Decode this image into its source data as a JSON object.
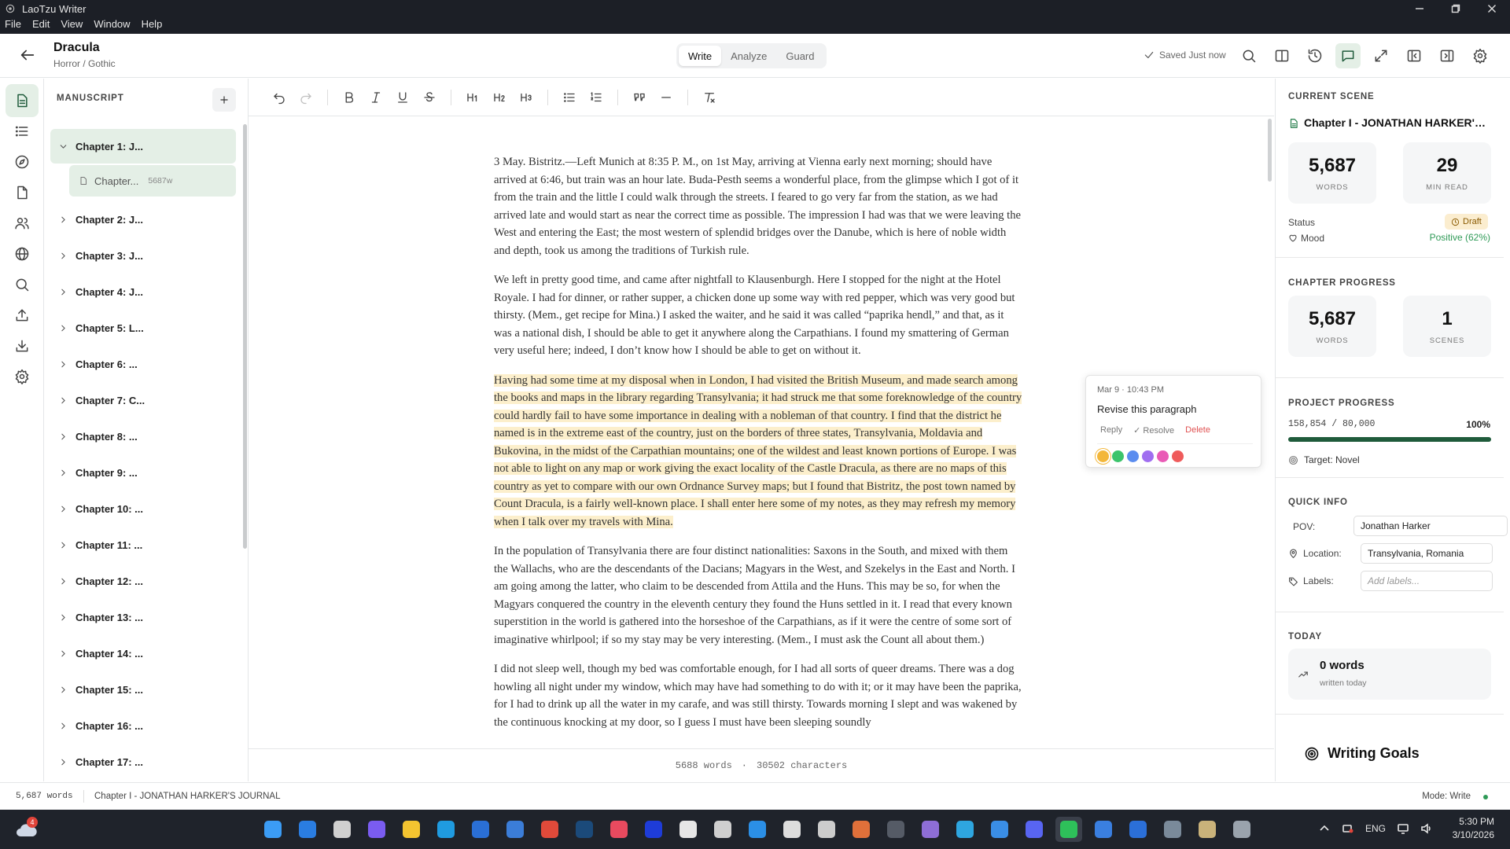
{
  "os": {
    "window_title": "LaoTzu Writer",
    "menu": [
      "File",
      "Edit",
      "View",
      "Window",
      "Help"
    ]
  },
  "header": {
    "title": "Dracula",
    "genre": "Horror / Gothic",
    "tabs": [
      "Write",
      "Analyze",
      "Guard"
    ],
    "active_tab": "Write",
    "saved_status": "Saved Just now",
    "tools": [
      "search-icon",
      "split-view-icon",
      "history-icon",
      "comments-icon",
      "expand-icon",
      "left-panel-icon",
      "right-panel-icon",
      "settings-icon"
    ]
  },
  "rail": [
    "manuscript-icon",
    "outline-icon",
    "compass-icon",
    "notes-icon",
    "characters-icon",
    "world-icon",
    "search-icon",
    "export-icon",
    "import-icon",
    "settings-icon"
  ],
  "manuscript": {
    "title": "MANUSCRIPT",
    "open_chapter": "Chapter 1: J...",
    "scene": {
      "label": "Chapter...",
      "words": "5687w"
    },
    "chapters": [
      "Chapter 2: J...",
      "Chapter 3: J...",
      "Chapter 4: J...",
      "Chapter 5: L...",
      "Chapter 6: ...",
      "Chapter 7: C...",
      "Chapter 8: ...",
      "Chapter 9: ...",
      "Chapter 10: ...",
      "Chapter 11: ...",
      "Chapter 12: ...",
      "Chapter 13: ...",
      "Chapter 14: ...",
      "Chapter 15: ...",
      "Chapter 16: ...",
      "Chapter 17: ..."
    ]
  },
  "editor": {
    "paragraphs": [
      "3 May. Bistritz.—Left Munich at 8:35 P. M., on 1st May, arriving at Vienna early next morning; should have arrived at 6:46, but train was an hour late. Buda-Pesth seems a wonderful place, from the glimpse which I got of it from the train and the little I could walk through the streets. I feared to go very far from the station, as we had arrived late and would start as near the correct time as possible. The impression I had was that we were leaving the West and entering the East; the most western of splendid bridges over the Danube, which is here of noble width and depth, took us among the traditions of Turkish rule.",
      "We left in pretty good time, and came after nightfall to Klausenburgh. Here I stopped for the night at the Hotel Royale. I had for dinner, or rather supper, a chicken done up some way with red pepper, which was very good but thirsty. (Mem., get recipe for Mina.) I asked the waiter, and he said it was called “paprika hendl,” and that, as it was a national dish, I should be able to get it anywhere along the Carpathians. I found my smattering of German very useful here; indeed, I don’t know how I should be able to get on without it.",
      "Having had some time at my disposal when in London, I had visited the British Museum, and made search among the books and maps in the library regarding Transylvania; it had struck me that some foreknowledge of the country could hardly fail to have some importance in dealing with a nobleman of that country. I find that the district he named is in the extreme east of the country, just on the borders of three states, Transylvania, Moldavia and Bukovina, in the midst of the Carpathian mountains; one of the wildest and least known portions of Europe. I was not able to light on any map or work giving the exact locality of the Castle Dracula, as there are no maps of this country as yet to compare with our own Ordnance Survey maps; but I found that Bistritz, the post town named by Count Dracula, is a fairly well-known place. I shall enter here some of my notes, as they may refresh my memory when I talk over my travels with Mina.",
      "In the population of Transylvania there are four distinct nationalities: Saxons in the South, and mixed with them the Wallachs, who are the descendants of the Dacians; Magyars in the West, and Szekelys in the East and North. I am going among the latter, who claim to be descended from Attila and the Huns. This may be so, for when the Magyars conquered the country in the eleventh century they found the Huns settled in it. I read that every known superstition in the world is gathered into the horseshoe of the Carpathians, as if it were the centre of some sort of imaginative whirlpool; if so my stay may be very interesting. (Mem., I must ask the Count all about them.)",
      "I did not sleep well, though my bed was comfortable enough, for I had all sorts of queer dreams. There was a dog howling all night under my window, which may have had something to do with it; or it may have been the paprika, for I had to drink up all the water in my carafe, and was still thirsty. Towards morning I slept and was wakened by the continuous knocking at my door, so I guess I must have been sleeping soundly"
    ],
    "footer_words": "5688 words",
    "footer_sep": "·",
    "footer_chars": "30502 characters"
  },
  "comment": {
    "date": "Mar 9 · 10:43 PM",
    "text": "Revise this paragraph",
    "reply": "Reply",
    "resolve": "✓ Resolve",
    "delete": "Delete",
    "colors": [
      "#f3b73a",
      "#3cc46b",
      "#5b8def",
      "#a06ef0",
      "#e95bb6",
      "#ef5b5b"
    ]
  },
  "right": {
    "current_scene_title": "CURRENT SCENE",
    "scene_name": "Chapter I - JONATHAN HARKER'S JOURNAL",
    "words": "5,687",
    "words_label": "WORDS",
    "min_read": "29",
    "min_read_label": "MIN READ",
    "status_label": "Status",
    "status_value": "Draft",
    "mood_label": "Mood",
    "mood_value": "Positive (62%)",
    "chapter_progress_title": "CHAPTER PROGRESS",
    "ch_words": "5,687",
    "ch_words_label": "WORDS",
    "ch_scenes": "1",
    "ch_scenes_label": "SCENES",
    "project_progress_title": "PROJECT PROGRESS",
    "project_count": "158,854 / 80,000",
    "project_pct": "100%",
    "project_fill": 1.0,
    "target": "Target: Novel",
    "quick_info_title": "QUICK INFO",
    "pov_label": "POV:",
    "pov_value": "Jonathan Harker",
    "location_label": "Location:",
    "location_value": "Transylvania, Romania",
    "labels_label": "Labels:",
    "labels_placeholder": "Add labels...",
    "today_title": "TODAY",
    "today_words": "0 words",
    "today_sub": "written today",
    "writing_goals": "Writing Goals"
  },
  "statusbar": {
    "words": "5,687 words",
    "chapter": "Chapter I - JONATHAN HARKER'S JOURNAL",
    "mode": "Mode: Write"
  },
  "taskbar": {
    "weather_badge": "4",
    "lang": "ENG",
    "time": "5:30 PM",
    "date": "3/10/2026",
    "apps": [
      {
        "name": "start-icon",
        "color": "#3b9cf5"
      },
      {
        "name": "search-icon",
        "color": "#2a7de1"
      },
      {
        "name": "task-view-icon",
        "color": "#d0d0d0"
      },
      {
        "name": "copilot-icon",
        "color": "#7a5cf0"
      },
      {
        "name": "file-explorer-icon",
        "color": "#f4c430"
      },
      {
        "name": "edge-icon",
        "color": "#1f9be0"
      },
      {
        "name": "mail-icon",
        "color": "#2a6fd6"
      },
      {
        "name": "app-icon",
        "color": "#3b7dd8"
      },
      {
        "name": "chrome-icon",
        "color": "#e04a3a"
      },
      {
        "name": "steam-icon",
        "color": "#1b4a7a"
      },
      {
        "name": "app-icon",
        "color": "#e84a5f"
      },
      {
        "name": "app-icon",
        "color": "#1e3cd8"
      },
      {
        "name": "app-icon",
        "color": "#e6e6e6"
      },
      {
        "name": "chatgpt-icon",
        "color": "#cfcfcf"
      },
      {
        "name": "vscode-icon",
        "color": "#2b8fe6"
      },
      {
        "name": "app-icon",
        "color": "#dddddd"
      },
      {
        "name": "app-icon",
        "color": "#cccccc"
      },
      {
        "name": "claude-icon",
        "color": "#e0703a"
      },
      {
        "name": "terminal-icon",
        "color": "#555b66"
      },
      {
        "name": "github-icon",
        "color": "#8e6ed6"
      },
      {
        "name": "telegram-icon",
        "color": "#2ea6e0"
      },
      {
        "name": "photos-icon",
        "color": "#3a8ee6"
      },
      {
        "name": "discord-icon",
        "color": "#5865f2"
      },
      {
        "name": "wechat-icon",
        "color": "#2ec05a"
      },
      {
        "name": "notes-icon",
        "color": "#3a7fe0"
      },
      {
        "name": "shield-icon",
        "color": "#2b6fd8"
      },
      {
        "name": "settings-icon",
        "color": "#7a8a9a"
      },
      {
        "name": "app-icon",
        "color": "#c9b27a"
      },
      {
        "name": "laotzu-icon",
        "color": "#9aa3ad"
      }
    ]
  }
}
